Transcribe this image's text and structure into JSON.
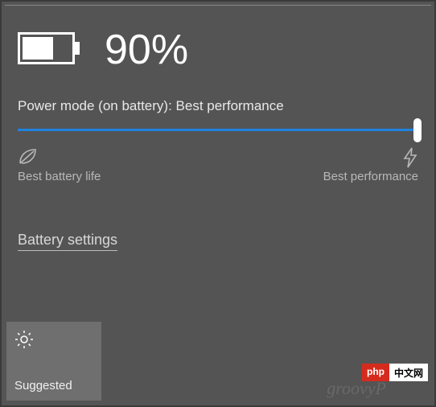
{
  "header": {
    "battery_percent": "90%"
  },
  "power_mode": {
    "label": "Power mode (on battery): Best performance"
  },
  "slider": {
    "left_label": "Best battery life",
    "right_label": "Best performance",
    "position": 100,
    "track_color": "#1f82e0"
  },
  "links": {
    "battery_settings": "Battery settings"
  },
  "tiles": {
    "brightness_label": "Suggested"
  },
  "watermark": "groovyP",
  "badge": {
    "left": "php",
    "right": "中文网"
  }
}
